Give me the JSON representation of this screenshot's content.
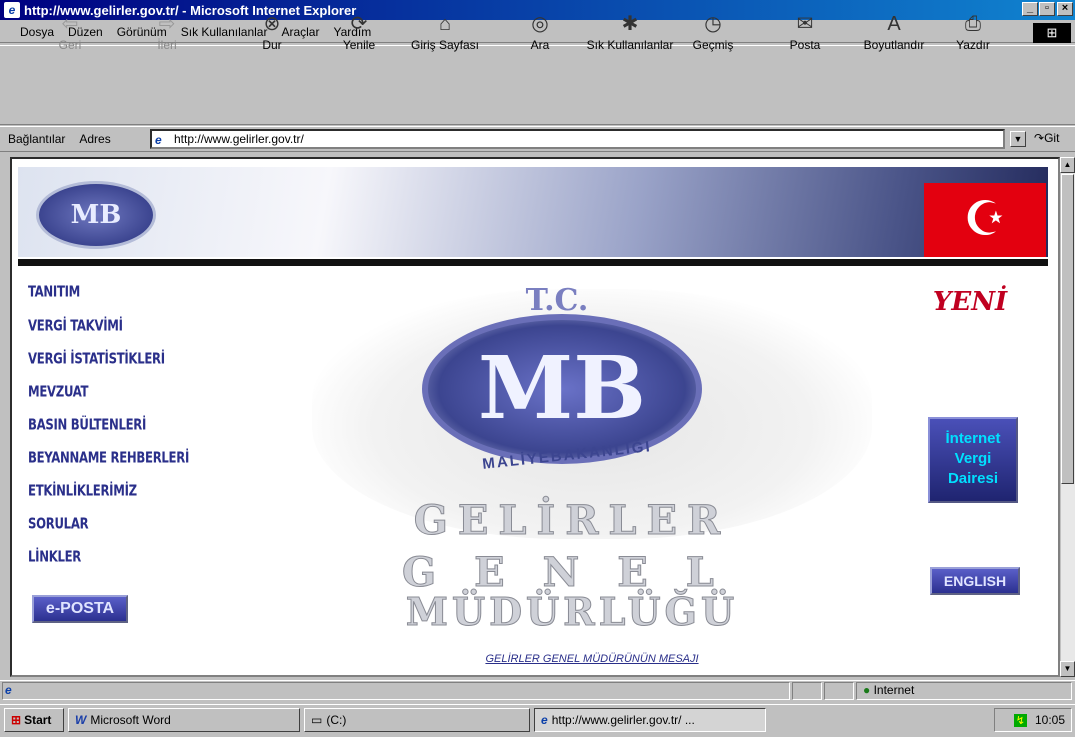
{
  "window": {
    "title": "http://www.gelirler.gov.tr/ - Microsoft Internet Explorer"
  },
  "menu": [
    "Dosya",
    "Düzen",
    "Görünüm",
    "Sık Kullanılanlar",
    "Araçlar",
    "Yardım"
  ],
  "toolbar": {
    "back": "Geri",
    "forward": "İleri",
    "stop": "Dur",
    "refresh": "Yenile",
    "home": "Giriş Sayfası",
    "search": "Ara",
    "favorites": "Sık Kullanılanlar",
    "history": "Geçmiş",
    "mail": "Posta",
    "size": "Boyutlandır",
    "print": "Yazdır"
  },
  "address": {
    "links_label": "Bağlantılar",
    "address_label": "Adres",
    "url": "http://www.gelirler.gov.tr/",
    "go": "Git"
  },
  "page": {
    "nav": [
      "TANITIM",
      "VERGİ TAKVİMİ",
      "VERGİ İSTATİSTİKLERİ",
      "MEVZUAT",
      "BASIN BÜLTENLERİ",
      "BEYANNAME REHBERLERİ",
      "ETKİNLİKLERİMİZ",
      "SORULAR",
      "LİNKLER"
    ],
    "eposta": "e-POSTA",
    "seal_top": "T.C.",
    "seal_text": "MB",
    "seal_sub": "MALİYEBAKANLIĞI",
    "title_lines": [
      "GELİRLER",
      "GENEL",
      "MÜDÜRLÜĞÜ"
    ],
    "yeni": "YENİ",
    "ivd": [
      "İnternet",
      "Vergi",
      "Dairesi"
    ],
    "english": "ENGLISH",
    "message_link": "GELİRLER GENEL MÜDÜRÜNÜN MESAJI"
  },
  "status": {
    "zone": "Internet"
  },
  "taskbar": {
    "start": "Start",
    "word": "Microsoft Word",
    "drive": "(C:)",
    "ie": "http://www.gelirler.gov.tr/ ...",
    "time": "10:05"
  }
}
